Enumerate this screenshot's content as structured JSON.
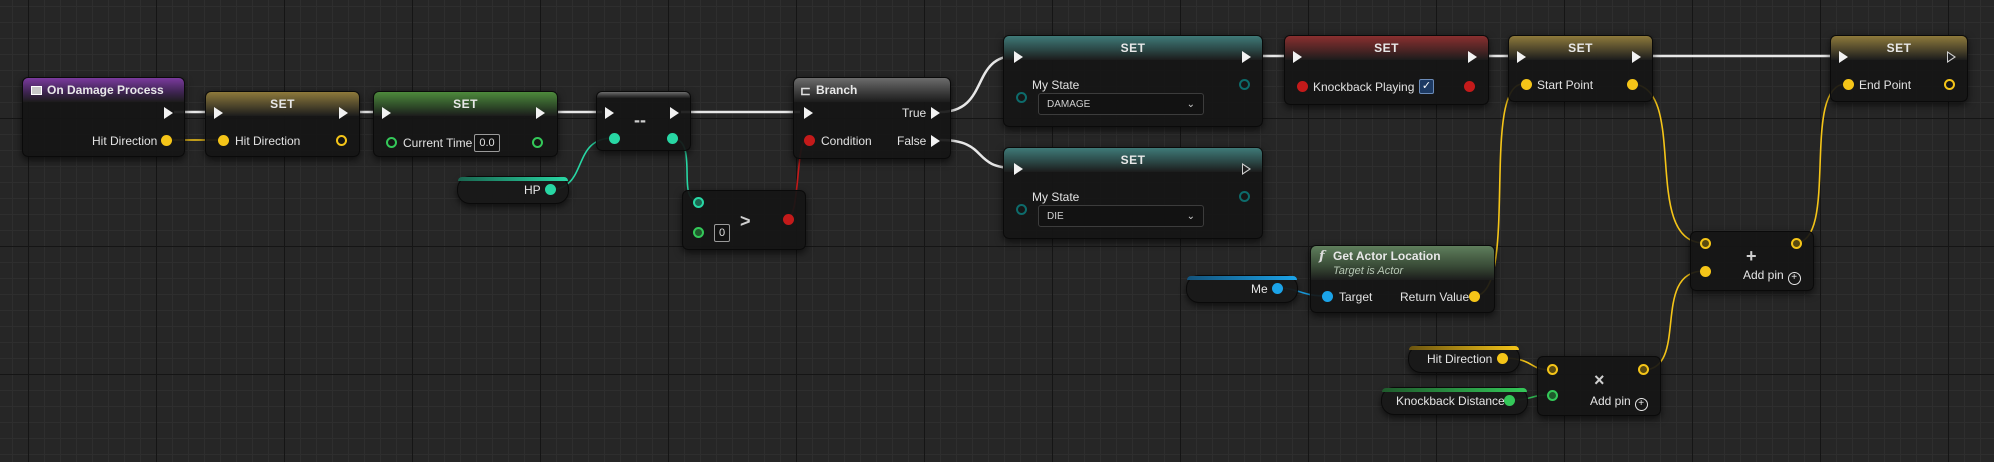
{
  "colors": {
    "exec": "#f2f2f2",
    "vector": "#f5c518",
    "float": "#28d7a4",
    "int": "#34c859",
    "bool": "#c41a1a",
    "enum": "#0d6b6b",
    "object": "#1ba3e8"
  },
  "nodes": {
    "event": {
      "title": "On Damage Process",
      "pin_hit_direction": "Hit Direction"
    },
    "set1": {
      "title": "SET",
      "pin_hit_direction": "Hit Direction"
    },
    "set2": {
      "title": "SET",
      "pin_current_time": "Current Time",
      "current_time_value": "0.0"
    },
    "decrement": {
      "op": "--"
    },
    "compare": {
      "op": ">",
      "int_value": "0"
    },
    "branch": {
      "title": "Branch",
      "pin_condition": "Condition",
      "pin_true": "True",
      "pin_false": "False"
    },
    "set_damage": {
      "title": "SET",
      "pin_my_state": "My State",
      "value": "DAMAGE"
    },
    "set_die": {
      "title": "SET",
      "pin_my_state": "My State",
      "value": "DIE"
    },
    "set_knockback": {
      "title": "SET",
      "pin_knockback_playing": "Knockback Playing",
      "checked": "✓"
    },
    "set_start": {
      "title": "SET",
      "pin_start_point": "Start Point"
    },
    "set_end": {
      "title": "SET",
      "pin_end_point": "End Point"
    },
    "get_actor_location": {
      "title": "Get Actor Location",
      "subtitle": "Target is Actor",
      "pin_target": "Target",
      "pin_return": "Return Value"
    },
    "add_vector": {
      "op": "+",
      "add_pin": "Add pin"
    },
    "multiply": {
      "op": "×",
      "add_pin": "Add pin"
    }
  },
  "variables": {
    "hp": "HP",
    "me": "Me",
    "hit_direction": "Hit Direction",
    "knockback_distance": "Knockback Distance"
  }
}
